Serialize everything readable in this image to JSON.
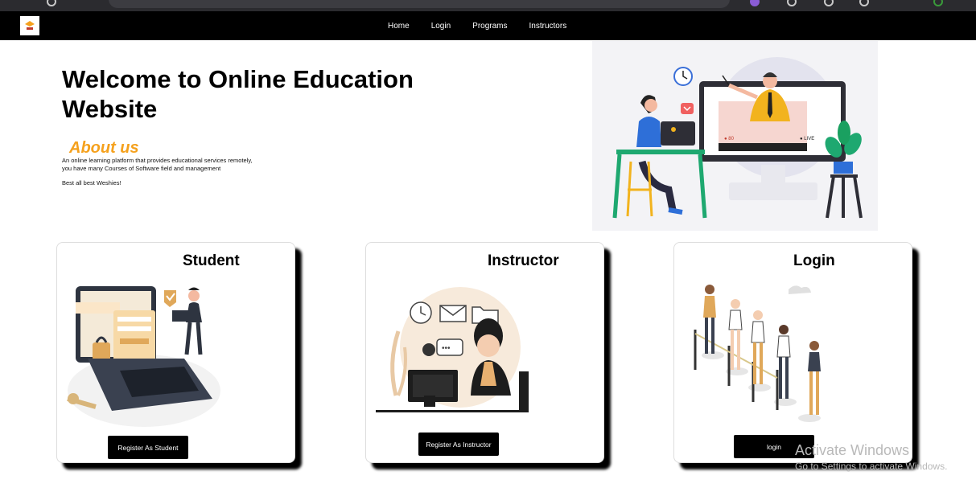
{
  "navbar": {
    "logo": "site-logo",
    "links": [
      "Home",
      "Login",
      "Programs",
      "Instructors"
    ]
  },
  "hero": {
    "title": "Welcome to Online Education Website",
    "about_heading": "About us",
    "about_line1": "An online learning platform that provides educational services remotely,",
    "about_line2": "you have many Courses of Software field and management",
    "about_sign": "Best all best Weshies!"
  },
  "cards": {
    "student": {
      "title": "Student",
      "button": "Register As Student",
      "illustration": "login-laptop-illustration"
    },
    "instructor": {
      "title": "Instructor",
      "button": "Register As Instructor",
      "illustration": "support-agent-illustration"
    },
    "login": {
      "title": "Login",
      "button": "login",
      "illustration": "queue-people-illustration"
    }
  },
  "watermark": {
    "line1": "Activate Windows",
    "line2": "Go to Settings to activate Windows."
  },
  "colors": {
    "accent": "#f5a11d",
    "navbar": "#000000",
    "button": "#000000"
  }
}
